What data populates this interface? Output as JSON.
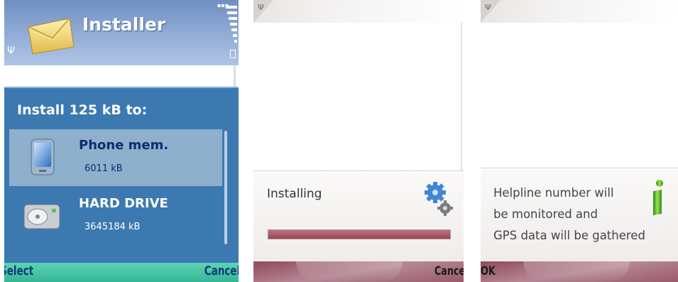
{
  "screen1": {
    "title": "Installer",
    "dialog_title": "Install 125 kB to:",
    "options": [
      {
        "name": "Phone mem.",
        "size": "6011 kB",
        "icon": "phone-icon",
        "selected": true
      },
      {
        "name": "HARD DRIVE",
        "size": "3645184 kB",
        "icon": "hard-drive-icon",
        "selected": false
      }
    ],
    "soft_left": "Select",
    "soft_right": "Cancel"
  },
  "screen2": {
    "status_text": "Installing",
    "progress_fraction": 1.0,
    "soft_right": "Cancel"
  },
  "screen3": {
    "message_lines": [
      "Helpline number will",
      "be monitored and",
      "GPS data will be gathered"
    ],
    "soft_left": "OK"
  },
  "colors": {
    "header_blue": "#7f9fcf",
    "dialog_blue": "#3c79b0",
    "selection": "#8eb0cd",
    "softkey_green": "#4ac5a5",
    "progress_red": "#a64d61",
    "softkey_mauve": "#a3687a"
  }
}
